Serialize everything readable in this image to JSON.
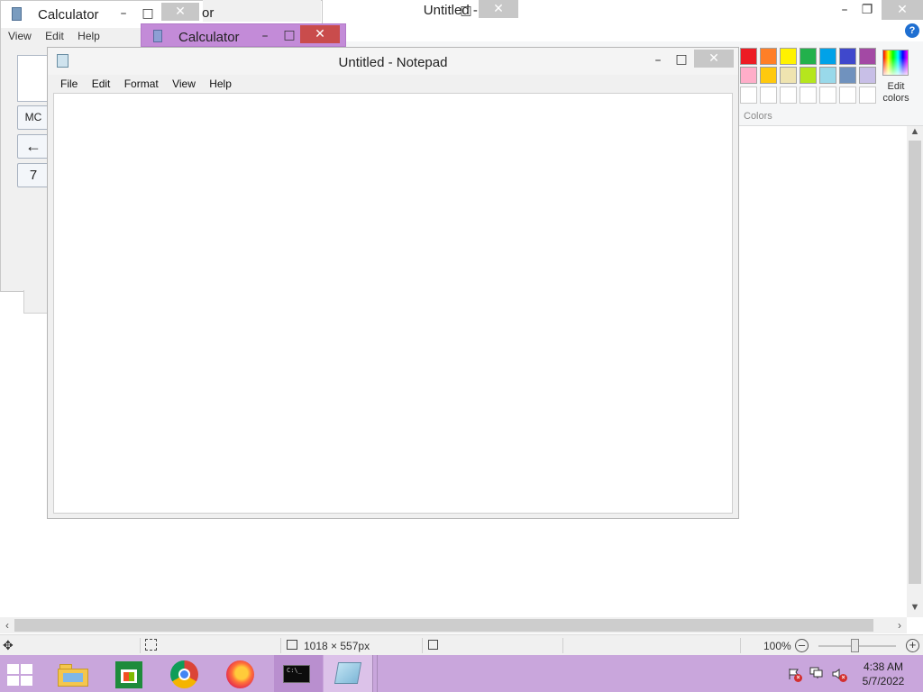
{
  "paint": {
    "title": "Untitled - Paint",
    "help_glyph": "?",
    "colors_label": "Colors",
    "edit_colors_label": "Edit colors",
    "palette_row1": [
      "#ed1c24",
      "#ff7f27",
      "#fff200",
      "#22b14c",
      "#00a2e8",
      "#3f48cc",
      "#a349a4"
    ],
    "palette_row2": [
      "#ffaec9",
      "#ffc90e",
      "#efe4b0",
      "#b5e61d",
      "#99d9ea",
      "#7092be",
      "#c8bfe7"
    ],
    "status": {
      "canvas_size": "1018 × 557px",
      "zoom": "100%",
      "zoom_level_fraction": 0.47
    }
  },
  "calculator_back": {
    "title": "Calculator",
    "menu": [
      "View",
      "Edit",
      "Help"
    ],
    "buttons": {
      "mc": "MC",
      "backspace": "←",
      "seven": "7"
    }
  },
  "calculator_hidden": {
    "partial_title": "or"
  },
  "calculator_front": {
    "title": "Calculator"
  },
  "notepad": {
    "title": "Untitled - Notepad",
    "menu": [
      "File",
      "Edit",
      "Format",
      "View",
      "Help"
    ],
    "content": ""
  },
  "window_controls": {
    "minimize": "–",
    "maximize": "□",
    "restore": "❐",
    "close": "✕"
  },
  "taskbar": {
    "cmd_icon_text": "C:\\_",
    "clock_time": "4:38 AM",
    "clock_date": "5/7/2022",
    "colors": {
      "background": "#c9a6dc",
      "active_item": "#dcc2e9"
    }
  }
}
